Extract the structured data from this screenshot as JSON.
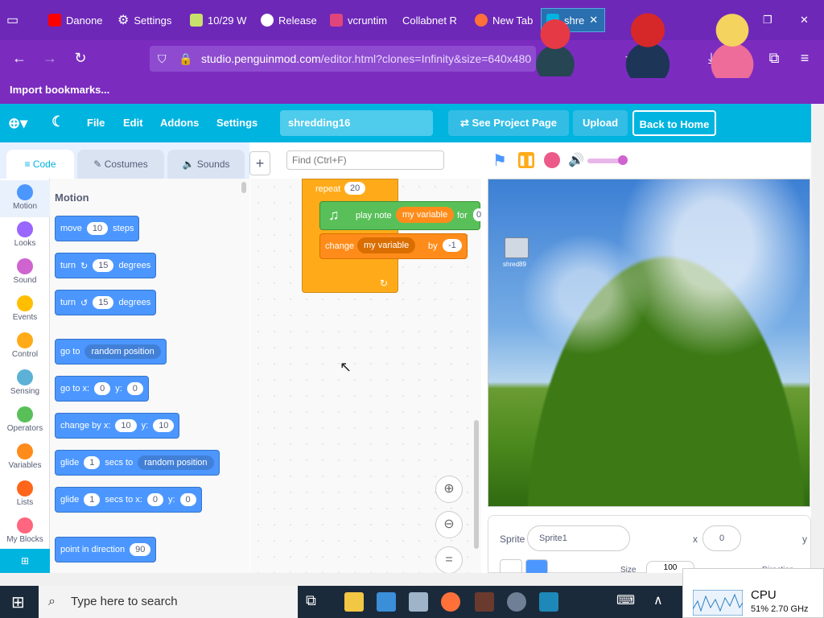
{
  "browser": {
    "tabs": [
      {
        "label": "Danone",
        "icon": "youtube-icon",
        "color": "#ff0000"
      },
      {
        "label": "Settings",
        "icon": "gear-icon",
        "color": "#ffffff"
      },
      {
        "label": "10/29 W",
        "icon": "leaf-icon",
        "color": "#c8e06c"
      },
      {
        "label": "Release",
        "icon": "github-icon",
        "color": "#ffffff"
      },
      {
        "label": "vcruntim",
        "icon": "page-icon",
        "color": "#e0457b"
      },
      {
        "label": "Collabnet R",
        "icon": "page-icon",
        "color": "#ffffff"
      },
      {
        "label": "New Tab",
        "icon": "firefox-icon",
        "color": "#ff7139"
      },
      {
        "label": "shre",
        "icon": "penguin-icon",
        "color": "#00b4e0"
      }
    ],
    "url_host": "studio.penguinmod.com",
    "url_path": "/editor.html?clones=Infinity&size=640x480",
    "bookmarks_label": "Import bookmarks..."
  },
  "menubar": {
    "file": "File",
    "edit": "Edit",
    "addons": "Addons",
    "settings": "Settings",
    "project_title": "shredding16",
    "see_project_page": "See Project Page",
    "upload": "Upload",
    "back_to_home": "Back to Home"
  },
  "editor_tabs": {
    "code": "Code",
    "costumes": "Costumes",
    "sounds": "Sounds"
  },
  "find_placeholder": "Find (Ctrl+F)",
  "categories": [
    {
      "label": "Motion",
      "color": "#4c97ff"
    },
    {
      "label": "Looks",
      "color": "#9966ff"
    },
    {
      "label": "Sound",
      "color": "#cf63cf"
    },
    {
      "label": "Events",
      "color": "#ffbf00"
    },
    {
      "label": "Control",
      "color": "#ffab19"
    },
    {
      "label": "Sensing",
      "color": "#5cb1d6"
    },
    {
      "label": "Operators",
      "color": "#59c059"
    },
    {
      "label": "Variables",
      "color": "#ff8c1a"
    },
    {
      "label": "Lists",
      "color": "#ff661a"
    },
    {
      "label": "My Blocks",
      "color": "#ff6680"
    }
  ],
  "palette": {
    "heading": "Motion",
    "move": {
      "a": "move",
      "v": "10",
      "b": "steps"
    },
    "turn_right": {
      "a": "turn",
      "v": "15",
      "b": "degrees"
    },
    "turn_left": {
      "a": "turn",
      "v": "15",
      "b": "degrees"
    },
    "goto": {
      "a": "go to",
      "dd": "random position"
    },
    "gotoxy": {
      "a": "go to x:",
      "x": "0",
      "ylab": "y:",
      "y": "0"
    },
    "changexy": {
      "a": "change by x:",
      "x": "10",
      "ylab": "y:",
      "y": "10"
    },
    "glide": {
      "a": "glide",
      "v": "1",
      "b": "secs to",
      "dd": "random position"
    },
    "glidexy": {
      "a": "glide",
      "v": "1",
      "b": "secs to x:",
      "x": "0",
      "ylab": "y:",
      "y": "0"
    },
    "point": {
      "a": "point in direction",
      "v": "90"
    }
  },
  "script": {
    "repeat_label": "repeat",
    "repeat_count": "20",
    "play_note": "play note",
    "my_variable": "my variable",
    "for_label": "for",
    "for_value": "0",
    "change_label": "change",
    "by_label": "by",
    "by_value": "-1"
  },
  "stage": {
    "desktop_icon_label": "shred89"
  },
  "sprite_info": {
    "sprite_label": "Sprite",
    "sprite_name": "Sprite1",
    "x_label": "x",
    "x_value": "0",
    "y_label": "y",
    "size_label": "Size",
    "size_value": "100",
    "direction_label": "Direction"
  },
  "taskbar": {
    "search_placeholder": "Type here to search",
    "cpu_label": "CPU",
    "cpu_value": "51%  2.70 GHz"
  }
}
